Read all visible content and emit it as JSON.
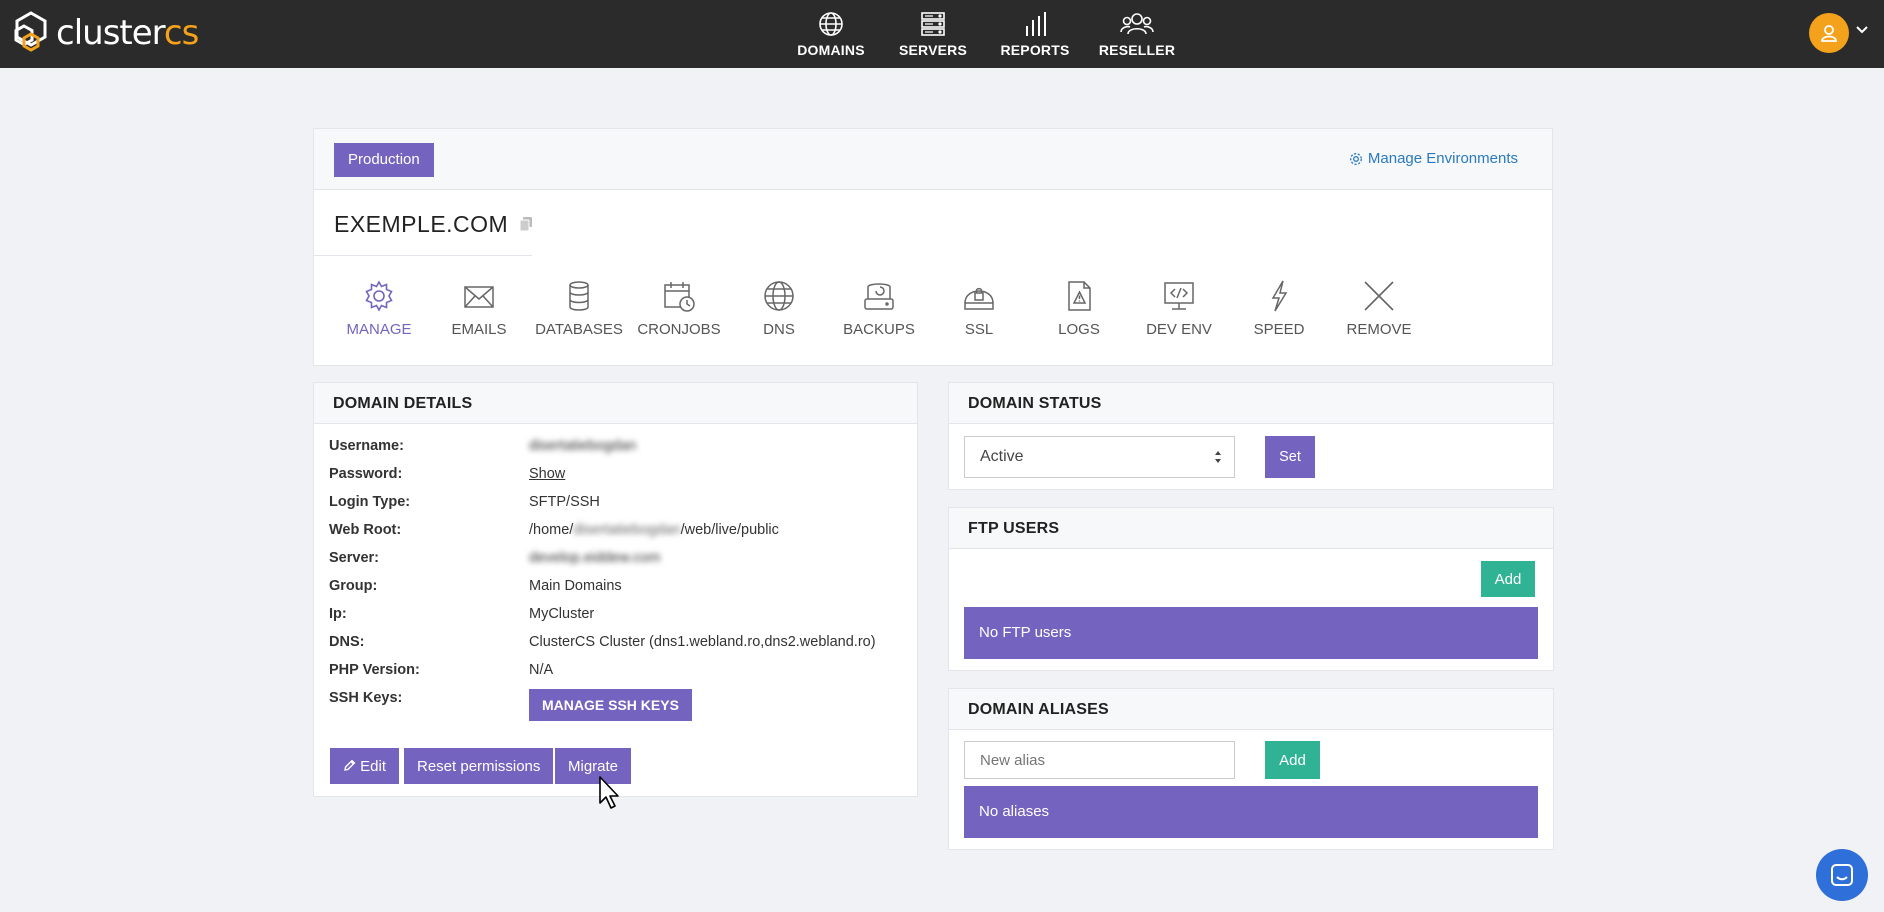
{
  "logo": {
    "text_main": "cluster",
    "text_accent": "cs"
  },
  "nav": [
    {
      "label": "DOMAINS",
      "icon": "globe-icon"
    },
    {
      "label": "SERVERS",
      "icon": "server-icon"
    },
    {
      "label": "REPORTS",
      "icon": "bar-chart-icon"
    },
    {
      "label": "RESELLER",
      "icon": "users-icon"
    }
  ],
  "environment": {
    "label": "Production",
    "manage_label": "Manage Environments"
  },
  "domain": {
    "title": "EXEMPLE.COM"
  },
  "tabs": [
    {
      "label": "MANAGE",
      "icon": "gear-icon"
    },
    {
      "label": "EMAILS",
      "icon": "envelope-icon"
    },
    {
      "label": "DATABASES",
      "icon": "database-icon"
    },
    {
      "label": "CRONJOBS",
      "icon": "calendar-clock-icon"
    },
    {
      "label": "DNS",
      "icon": "globe-icon"
    },
    {
      "label": "BACKUPS",
      "icon": "backup-drive-icon"
    },
    {
      "label": "SSL",
      "icon": "ssl-lock-icon"
    },
    {
      "label": "LOGS",
      "icon": "log-file-icon"
    },
    {
      "label": "DEV ENV",
      "icon": "code-monitor-icon"
    },
    {
      "label": "SPEED",
      "icon": "lightning-icon"
    },
    {
      "label": "REMOVE",
      "icon": "close-icon"
    }
  ],
  "details": {
    "header": "DOMAIN DETAILS",
    "rows": [
      {
        "label": "Username:",
        "value": "disertatiebogdan"
      },
      {
        "label": "Password:",
        "value": "Show"
      },
      {
        "label": "Login Type:",
        "value": "SFTP/SSH"
      },
      {
        "label": "Web Root:",
        "value_prefix": "/home/",
        "value_blur": "disertatiebogdan",
        "value_suffix": "/web/live/public"
      },
      {
        "label": "Server:",
        "value": "develop.eiddew.com"
      },
      {
        "label": "Group:",
        "value": "Main Domains"
      },
      {
        "label": "Ip:",
        "value": "MyCluster"
      },
      {
        "label": "DNS:",
        "value": "ClusterCS Cluster (dns1.webland.ro,dns2.webland.ro)"
      },
      {
        "label": "PHP Version:",
        "value": "N/A"
      },
      {
        "label": "SSH Keys:",
        "value": ""
      }
    ],
    "ssh_button": "MANAGE SSH KEYS",
    "edit_button": "Edit",
    "reset_button": "Reset permissions",
    "migrate_button": "Migrate"
  },
  "status": {
    "header": "DOMAIN STATUS",
    "selected": "Active",
    "set_button": "Set"
  },
  "ftp": {
    "header": "FTP USERS",
    "add_button": "Add",
    "empty": "No FTP users"
  },
  "aliases": {
    "header": "DOMAIN ALIASES",
    "placeholder": "New alias",
    "add_button": "Add",
    "empty": "No aliases"
  },
  "colors": {
    "accent": "#7464bf",
    "green": "#2fb394",
    "topbar": "#2b2b2b",
    "brand_orange": "#f4a21c",
    "link": "#2a7abf"
  }
}
